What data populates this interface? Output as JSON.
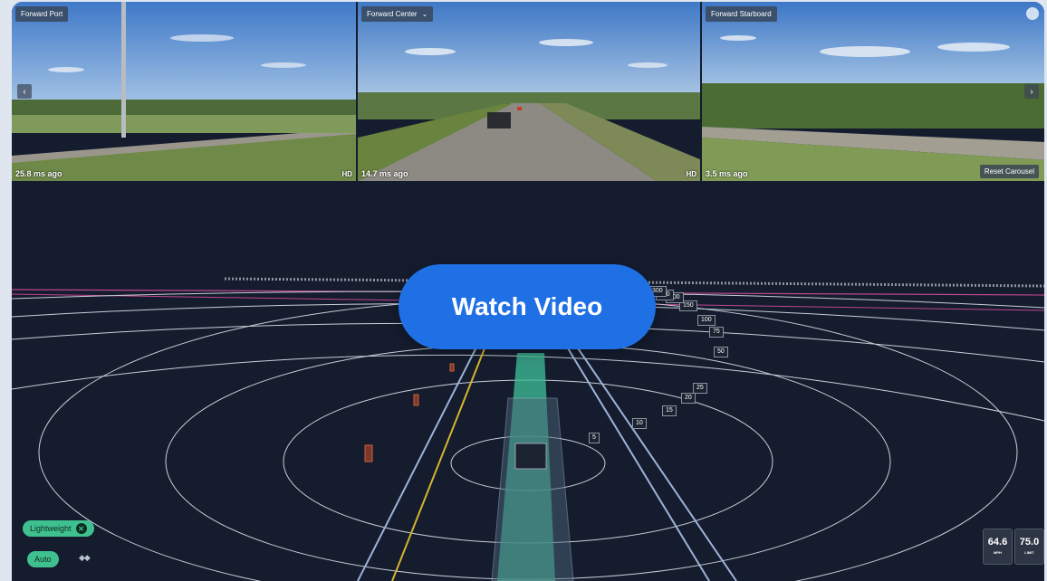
{
  "cameras": [
    {
      "label": "Forward Port",
      "time": "25.8 ms ago",
      "quality": "HD"
    },
    {
      "label": "Forward Center",
      "time": "14.7 ms ago",
      "quality": "HD"
    },
    {
      "label": "Forward Starboard",
      "time": "3.5 ms ago"
    }
  ],
  "carousel": {
    "reset_label": "Reset Carousel",
    "prev_icon": "‹",
    "next_icon": "›"
  },
  "overlay": {
    "watch_video_label": "Watch Video"
  },
  "controls": {
    "lightweight_label": "Lightweight",
    "close_icon": "✕",
    "auto_label": "Auto",
    "arrows_icon": "◆◆"
  },
  "speed": {
    "current_value": "64.6",
    "current_unit": "MPH",
    "limit_value": "75.0",
    "limit_unit": "LIMIT"
  },
  "distance_markers": {
    "d5": "5",
    "d10": "10",
    "d15": "15",
    "d20": "20",
    "d25": "25",
    "d50": "50",
    "d75": "75",
    "d100": "100",
    "d150": "150",
    "d200": "200",
    "d250": "250",
    "d300": "300"
  },
  "colors": {
    "accent": "#1f6fe5",
    "pill": "#3fc18f",
    "background": "#141c2e"
  }
}
